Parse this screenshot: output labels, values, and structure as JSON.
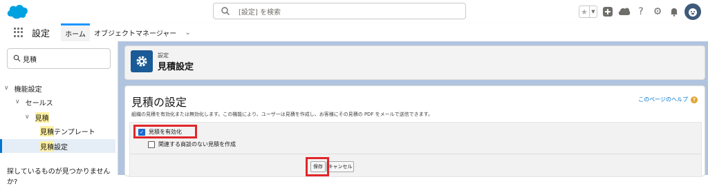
{
  "header": {
    "search_placeholder": "[設定] を検索",
    "icons": [
      "salesforce-cloud-logo",
      "star-icon",
      "chevron-down-icon",
      "plus-icon",
      "cloud-help-icon",
      "question-icon",
      "gear-icon",
      "bell-icon",
      "avatar"
    ]
  },
  "nav": {
    "app_name": "設定",
    "tab_home": "ホーム",
    "tab_object_manager": "オブジェクトマネージャー"
  },
  "sidebar": {
    "quick_find_value": "見積",
    "tree": [
      {
        "label": "機能設定"
      },
      {
        "label": "セールス"
      },
      {
        "label": "見積"
      },
      {
        "label_highlight": "見積",
        "label_rest": "テンプレート"
      },
      {
        "label_highlight": "見積",
        "label_rest": "設定"
      }
    ],
    "not_found": "探しているものが見つかりませんか?"
  },
  "page_header": {
    "breadcrumb": "設定",
    "title": "見積設定"
  },
  "panel": {
    "title": "見積の設定",
    "help_link": "このページのヘルプ",
    "description": "組織の見積を有効化または無効化します。この機能により、ユーザーは見積を作成し、お客様にその見積の PDF をメールで送信できます。",
    "checkbox_enable": {
      "label": "見積を有効化",
      "checked": true
    },
    "checkbox_no_opportunity": {
      "label": "関連する商談のない見積を作成",
      "checked": false
    },
    "save_button": "保存",
    "cancel_button": "キャンセル"
  },
  "colors": {
    "brand_blue": "#1b96ff",
    "header_icon_bg": "#1a5a96",
    "highlight_red": "#e0262a",
    "background": "#b0c4df"
  }
}
